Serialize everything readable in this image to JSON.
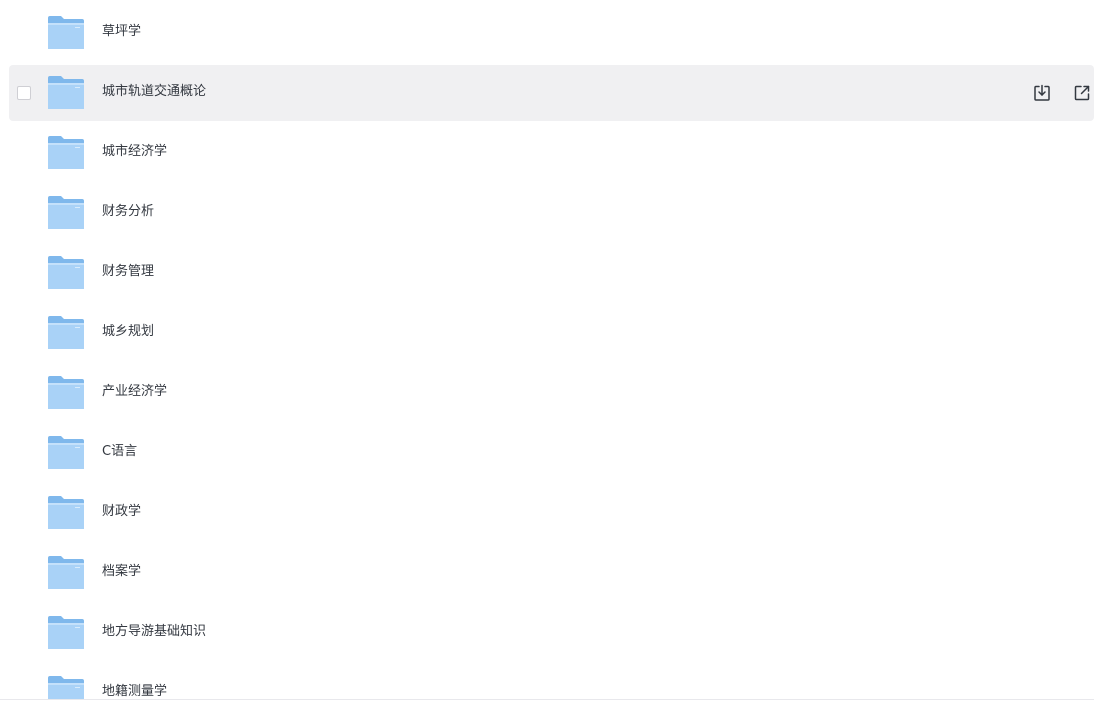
{
  "file_list": {
    "items": [
      {
        "name": "草坪学",
        "type": "folder"
      },
      {
        "name": "城市轨道交通概论",
        "type": "folder",
        "hovered": true
      },
      {
        "name": "城市经济学",
        "type": "folder"
      },
      {
        "name": "财务分析",
        "type": "folder"
      },
      {
        "name": "财务管理",
        "type": "folder"
      },
      {
        "name": "城乡规划",
        "type": "folder"
      },
      {
        "name": "产业经济学",
        "type": "folder"
      },
      {
        "name": "C语言",
        "type": "folder"
      },
      {
        "name": "财政学",
        "type": "folder"
      },
      {
        "name": "档案学",
        "type": "folder"
      },
      {
        "name": "地方导游基础知识",
        "type": "folder"
      },
      {
        "name": "地籍测量学",
        "type": "folder"
      }
    ],
    "row_actions": {
      "download_icon": "download-icon",
      "share_icon": "share-external-icon"
    }
  },
  "colors": {
    "hover_row_bg": "#f0f0f2",
    "folder_top": "#8cc1f1",
    "folder_body": "#a9d2f7",
    "text": "#333840",
    "icon": "#333840"
  }
}
